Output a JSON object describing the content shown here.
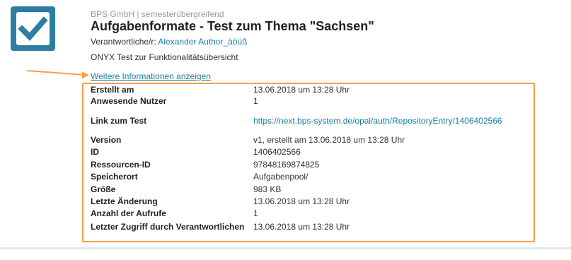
{
  "header": {
    "org_line": "BPS GmbH | semesterübergreifend",
    "title": "Aufgabenformate - Test zum Thema \"Sachsen\"",
    "owner_prefix": "Verantwortliche/r:",
    "owner_name": "Alexander Author_äöüß",
    "description": "ONYX Test zur Funktionalitätsübersicht",
    "logo_icon": "checkmark-icon",
    "accent_color": "#2c7fa3"
  },
  "more_link": "Weitere Informationen anzeigen",
  "details": [
    {
      "label": "Erstellt am",
      "value": "13.06.2018 um 13:28 Uhr"
    },
    {
      "label": "Anwesende Nutzer",
      "value": "1"
    },
    {
      "label": "Link zum Test",
      "value": "https://next.bps-system.de/opal/auth/RepositoryEntry/1406402566"
    },
    {
      "label": "Version",
      "value": "v1, erstellt am 13.06.2018 um 13:28 Uhr"
    },
    {
      "label": "ID",
      "value": "1406402566"
    },
    {
      "label": "Ressourcen-ID",
      "value": "97848169874825"
    },
    {
      "label": "Speicherort",
      "value": "Aufgabenpool/"
    },
    {
      "label": "Größe",
      "value": "983 KB"
    },
    {
      "label": "Letzte Änderung",
      "value": "13.06.2018 um 13:28 Uhr"
    },
    {
      "label": "Anzahl der Aufrufe",
      "value": "1"
    },
    {
      "label": "Letzter Zugriff durch Verantwortlichen",
      "value": "13.06.2018 um 13:28 Uhr"
    }
  ],
  "colors": {
    "link": "#1a7fa6",
    "highlight_box": "#f5a04a",
    "arrow": "#f5a04a"
  }
}
